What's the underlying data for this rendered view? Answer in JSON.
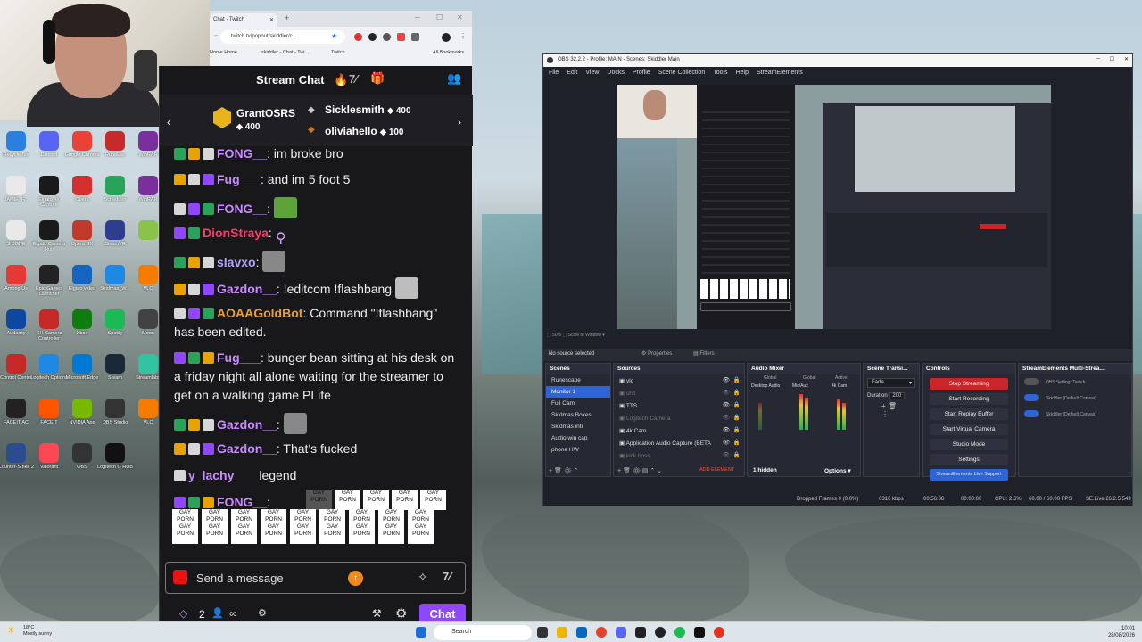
{
  "browser": {
    "tab_title": "Chat - Twitch",
    "url": "twitch.tv/popout/skiddler/c...",
    "bookmarks": [
      "Home Home...",
      "skiddler - Chat - Twi...",
      "Twitch"
    ],
    "all_bookmarks": "All Bookmarks"
  },
  "chat": {
    "title": "Stream Chat",
    "gifters": [
      {
        "name": "GrantOSRS",
        "amount": "400"
      },
      {
        "name": "Sicklesmith",
        "amount": "400"
      },
      {
        "name": "oliviahello",
        "amount": "100"
      }
    ],
    "messages": [
      {
        "user": "FONG__",
        "color": "#c88bff",
        "text": ": im broke bro"
      },
      {
        "user": "Fug___",
        "color": "#c88bff",
        "text": ": and im 5 foot 5"
      },
      {
        "user": "FONG__",
        "color": "#c88bff",
        "text": ":"
      },
      {
        "user": "DionStraya",
        "color": "#ff3a6a",
        "text": ":"
      },
      {
        "user": "slavxo",
        "color": "#b3a3ff",
        "text": ":"
      },
      {
        "user": "Gazdon__",
        "color": "#c88bff",
        "text": ": !editcom !flashbang"
      },
      {
        "user": "AOAAGoldBot",
        "color": "#e6a13a",
        "text": ": Command \"!flashbang\" has been edited."
      },
      {
        "user": "Fug___",
        "color": "#c88bff",
        "text": ": bunger bean sitting at his desk on a friday night all alone waiting for the streamer to get on a walking game PLife"
      },
      {
        "user": "Gazdon__",
        "color": "#c88bff",
        "text": ":"
      },
      {
        "user": "Gazdon__",
        "color": "#c88bff",
        "text": ": That's fucked"
      },
      {
        "user": "y_lachy",
        "color": "#c88bff",
        "text": "legend"
      },
      {
        "user": "FONG__",
        "color": "#c88bff",
        "text": ":"
      }
    ],
    "spam_text": "GAY PORN",
    "input_placeholder": "Send a message",
    "footer_count": "2",
    "chat_button": "Chat"
  },
  "obs": {
    "title": "OBS 32.2.2 - Profile: MAIN - Scenes: Skiddler Main",
    "menu": [
      "File",
      "Edit",
      "View",
      "Docks",
      "Profile",
      "Scene Collection",
      "Tools",
      "Help",
      "StreamElements"
    ],
    "no_source": "No source selected",
    "properties": "Properties",
    "filters": "Filters",
    "docks": {
      "scenes": "Scenes",
      "sources": "Sources",
      "mixer": "Audio Mixer",
      "transitions": "Scene Transi...",
      "controls": "Controls",
      "se": "StreamElements Multi-Strea..."
    },
    "scenes": [
      "Runescape",
      "Monitor 1",
      "Full Cam",
      "Skidmas Boxes",
      "Skidmas intr",
      "Audio win cap",
      "phone HW"
    ],
    "sources": [
      "vlc",
      "shit",
      "TTS",
      "Logitech Camera",
      "4k Cam",
      "Application Audio Capture (BETA",
      "kick boss"
    ],
    "add_element": "ADD ELEMENT",
    "mixer_tabs": [
      "Global",
      "Global",
      "Active"
    ],
    "mixer_channels": [
      "Desktop Audio",
      "Mic/Aux",
      "4k Cam"
    ],
    "hidden": "1 hidden",
    "options": "Options",
    "transition": {
      "type": "Fade",
      "duration_label": "Duration",
      "duration": "200"
    },
    "controls": [
      "Stop Streaming",
      "Start Recording",
      "Start Replay Buffer",
      "Start Virtual Camera",
      "Studio Mode",
      "Settings",
      "StreamElements Live Support"
    ],
    "se_items": [
      "OBS Setting: Twitch",
      "Skiddler (Default Canvas)",
      "Skiddler (Default Canvas)"
    ],
    "status": {
      "dropped": "Dropped Frames 0 (0.0%)",
      "kbps": "6316 kbps",
      "time1": "00:56:08",
      "time2": "00:00:00",
      "cpu": "CPU: 2.6%",
      "fps": "60.00 / 60.00 FPS",
      "se": "SE.Live 26.2.5.549"
    }
  },
  "taskbar": {
    "search": "Search",
    "time": "10:01",
    "date": "28/08/2026",
    "weather_temp": "18°C",
    "weather_desc": "Mostly sunny"
  },
  "desktop_icons": [
    "Recycle Bin",
    "Discord",
    "Google Chrome",
    "RuneLite",
    "WinRAR",
    "JAMIE_F...",
    "Elgato 4K Capture",
    "Opera",
    "Scheduler",
    "WinRAR",
    "S.DGNE",
    "Elgato Camera Hub",
    "Opera GX",
    "SteamVR",
    "",
    "Among Us",
    "Epic Games Launcher",
    "Elgato video",
    "Skidmas_W...",
    "VLC",
    "Audacity",
    "CH Camera Controller",
    "Xbox",
    "Spotify",
    "Moon",
    "Control Center",
    "Logitech Options",
    "Microsoft Edge",
    "Steam",
    "Streamlabs",
    "FACEIT AC",
    "FACEIT",
    "NVIDIA App",
    "OBS Studio",
    "VLC",
    "Counter-Strike 2",
    "Valorant",
    "OBS",
    "Logitech G HUB"
  ]
}
